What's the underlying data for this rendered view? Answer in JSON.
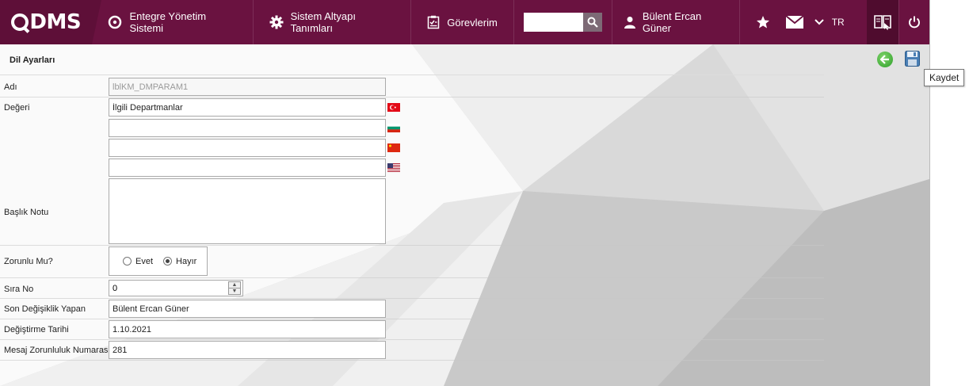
{
  "topbar": {
    "logo": "DMS",
    "nav": [
      {
        "label": "Entegre Yönetim Sistemi",
        "icon": "q-circle-icon"
      },
      {
        "label": "Sistem Altyapı Tanımları",
        "icon": "gear-icon"
      },
      {
        "label": "Görevlerim",
        "icon": "clipboard-icon"
      }
    ],
    "search": {
      "value": "",
      "placeholder": ""
    },
    "user": "Bülent Ercan Güner",
    "language": "TR"
  },
  "page": {
    "title": "Dil Ayarları",
    "tooltip": "Kaydet"
  },
  "form": {
    "adi": {
      "label": "Adı",
      "value": "lblKM_DMPARAM1"
    },
    "degeri": {
      "label": "Değeri",
      "tr": "İlgili Departmanlar",
      "bg": "",
      "cn": "",
      "us": ""
    },
    "baslik_notu": {
      "label": "Başlık Notu",
      "value": ""
    },
    "zorunlu": {
      "label": "Zorunlu Mu?",
      "options": [
        "Evet",
        "Hayır"
      ],
      "selected": "Hayır"
    },
    "sira_no": {
      "label": "Sıra No",
      "value": "0"
    },
    "son_degisiklik": {
      "label": "Son Değişiklik Yapan",
      "value": "Bülent Ercan Güner"
    },
    "degistirme_tarihi": {
      "label": "Değiştirme Tarihi",
      "value": "1.10.2021"
    },
    "mesaj_zorunluluk": {
      "label": "Mesaj Zorunluluk Numarası",
      "value": "281"
    }
  },
  "colors": {
    "topbar": "#6a1240",
    "accent_green": "#2e9f2a"
  }
}
